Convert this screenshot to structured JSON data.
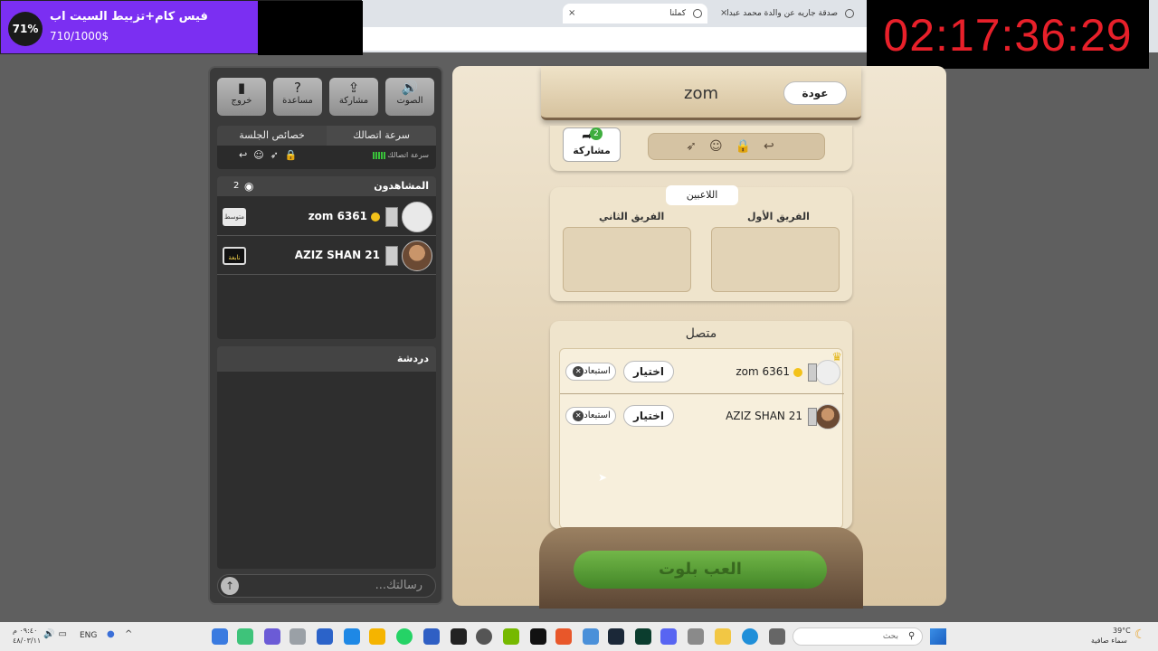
{
  "browser": {
    "tabs": [
      {
        "title": "كملنا",
        "active": true
      },
      {
        "title": "صدقة جاريه عن والدة محمد عبدا",
        "active": false
      }
    ],
    "new_tab": "+",
    "close": "×"
  },
  "goal_widget": {
    "percent": "71%",
    "title": "فيس كام+تزبيط السيت اب",
    "amount": "710/1000$"
  },
  "timer": "02:17:36:29",
  "left_panel": {
    "buttons": {
      "sound": "الصوت",
      "share": "مشاركة",
      "help": "مساعدة",
      "exit": "خروج"
    },
    "session": {
      "speed_tab": "سرعة اتصالك",
      "props_tab": "خصائص الجلسة",
      "speed_label": "سرعة اتصالك"
    },
    "viewers": {
      "title": "المشاهدون",
      "count": "2",
      "list": [
        {
          "name": "zom 6361",
          "badge": "متوسط"
        },
        {
          "name": "AZIZ SHAN 21",
          "badge": "نابغة"
        }
      ]
    },
    "chat": {
      "title": "دردشة",
      "placeholder": "رسالتك..."
    }
  },
  "board": {
    "room_name": "zom",
    "back_label": "عودة",
    "share_label": "مشاركة",
    "share_count": "2",
    "players_tab": "اللاعبين",
    "team1": "الفريق الأول",
    "team2": "الفريق الثاني",
    "connected_title": "متصل",
    "connected": [
      {
        "name": "zom 6361",
        "choose": "اختيار",
        "exclude": "استبعاد",
        "host": true
      },
      {
        "name": "AZIZ SHAN 21",
        "choose": "اختيار",
        "exclude": "استبعاد",
        "host": false
      }
    ],
    "play_label": "العب بلوت"
  },
  "taskbar": {
    "search_placeholder": "بحث",
    "lang": "ENG",
    "weather_temp": "39°C",
    "weather_desc": "سماء صافية",
    "time": "٠٩:٤٠ م",
    "date": "٤٨/٠٣/١١"
  },
  "colors": {
    "goal_purple": "#7b2ff2",
    "timer_red": "#e8202a",
    "play_green": "#4fa32e",
    "board_beige": "#efe4cc"
  },
  "icons": [
    "sound-icon",
    "share-icon",
    "help-icon",
    "exit-icon",
    "eye-icon",
    "lock-icon",
    "smile-icon",
    "crown-icon",
    "send-icon"
  ]
}
